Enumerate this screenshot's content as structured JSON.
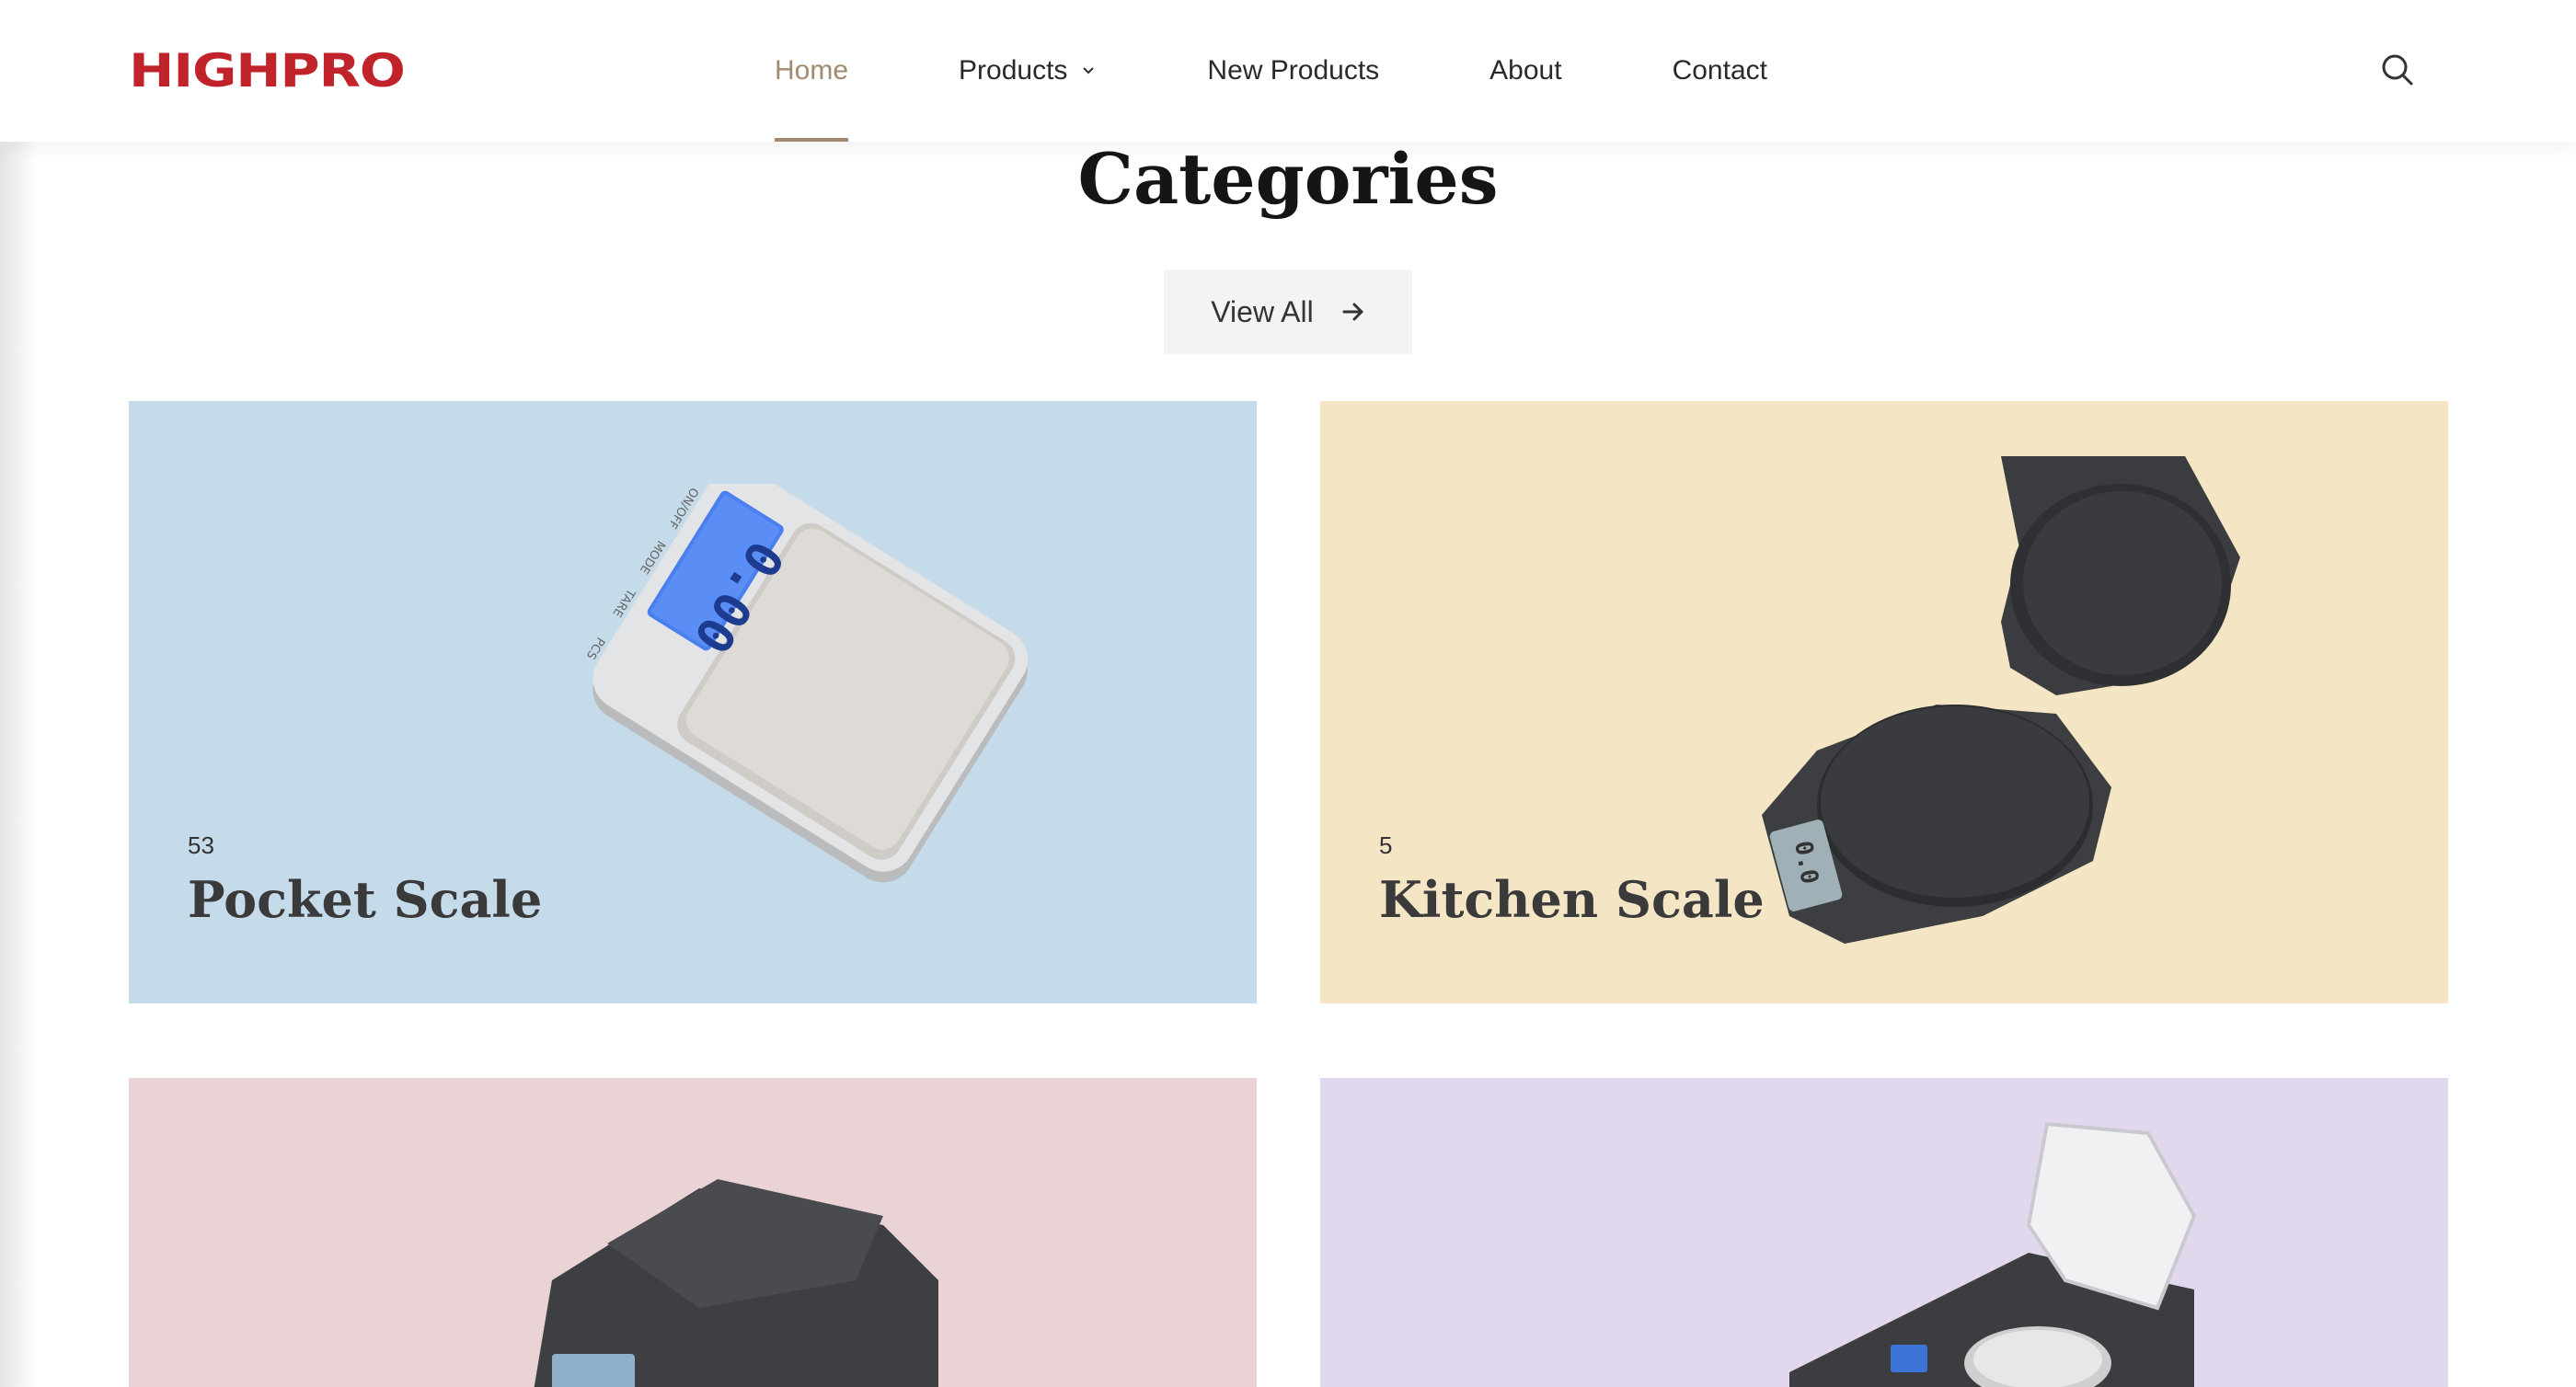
{
  "brand": {
    "logo_text": "HIGHPRO",
    "color": "#c1232b"
  },
  "nav": {
    "items": [
      {
        "label": "Home",
        "active": true
      },
      {
        "label": "Products",
        "has_dropdown": true
      },
      {
        "label": "New Products"
      },
      {
        "label": "About"
      },
      {
        "label": "Contact"
      }
    ],
    "active_color": "#a08a70",
    "search_icon": "search-icon"
  },
  "section": {
    "title": "Categories",
    "view_all_label": "View All",
    "view_all_icon": "arrow-right-icon"
  },
  "categories": [
    {
      "count": "53",
      "name": "Pocket Scale",
      "bg": "#c6dbea",
      "display_text": "0.00",
      "buttons": [
        "ON/OFF",
        "MODE",
        "TARE",
        "PCS"
      ]
    },
    {
      "count": "5",
      "name": "Kitchen Scale",
      "bg": "#f4e6c5",
      "display_text": "0.0"
    },
    {
      "count": "",
      "name": "",
      "bg": "#ead3d5"
    },
    {
      "count": "",
      "name": "",
      "bg": "#e2d8ee"
    }
  ]
}
